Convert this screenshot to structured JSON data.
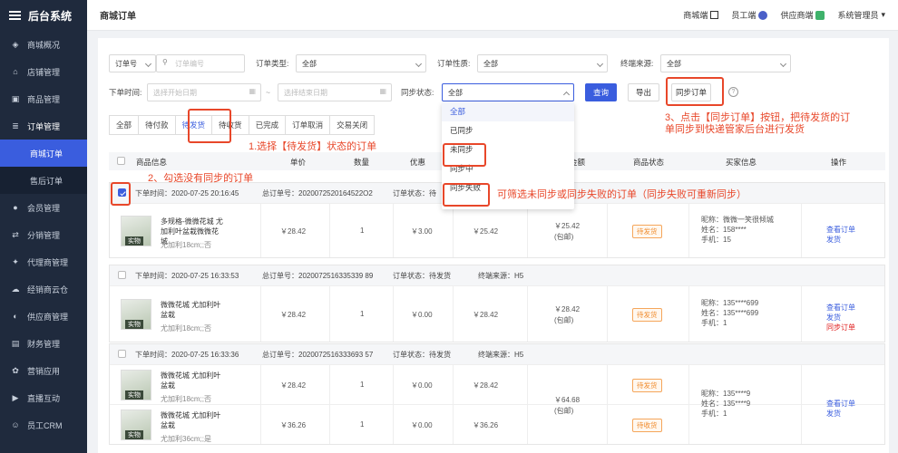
{
  "app": {
    "title": "后台系统"
  },
  "sidebar": {
    "items": [
      {
        "label": "商城概况",
        "icon": "layers-icon"
      },
      {
        "label": "店铺管理",
        "icon": "shop-icon"
      },
      {
        "label": "商品管理",
        "icon": "box-icon"
      },
      {
        "label": "订单管理",
        "icon": "order-icon"
      },
      {
        "label": "商城订单",
        "sub": true,
        "active": true
      },
      {
        "label": "售后订单",
        "sub": true
      },
      {
        "label": "会员管理",
        "icon": "user-icon"
      },
      {
        "label": "分销管理",
        "icon": "share-icon"
      },
      {
        "label": "代理商管理",
        "icon": "agent-icon"
      },
      {
        "label": "经销商云仓",
        "icon": "cloud-icon"
      },
      {
        "label": "供应商管理",
        "icon": "supplier-icon"
      },
      {
        "label": "财务管理",
        "icon": "wallet-icon"
      },
      {
        "label": "营销应用",
        "icon": "apps-icon"
      },
      {
        "label": "直播互动",
        "icon": "video-icon"
      },
      {
        "label": "员工CRM",
        "icon": "crm-icon"
      }
    ]
  },
  "topbar": {
    "page_title": "商城订单",
    "mall_end": "商城端",
    "staff_end": "员工端",
    "supplier_end": "供应商端",
    "admin": "系统管理员"
  },
  "filters": {
    "order_no_type": "订单号",
    "order_no_placeholder": "订单编号",
    "order_type_label": "订单类型:",
    "order_type_value": "全部",
    "order_nature_label": "订单性质:",
    "order_nature_value": "全部",
    "terminal_label": "终端来源:",
    "terminal_value": "全部",
    "time_label": "下单时间:",
    "start_placeholder": "选择开始日期",
    "end_placeholder": "选择结束日期",
    "sep": "~",
    "sync_label": "同步状态:",
    "sync_value": "全部",
    "search_btn": "查询",
    "export_btn": "导出",
    "sync_btn": "同步订单"
  },
  "tabs": [
    "全部",
    "待付款",
    "待发货",
    "待收货",
    "已完成",
    "订单取消",
    "交易关闭"
  ],
  "dropdown_options": [
    "全部",
    "已同步",
    "未同步",
    "同步中",
    "同步失败"
  ],
  "columns": [
    "商品信息",
    "单价",
    "数量",
    "优惠",
    "金额",
    "商品状态",
    "买家信息",
    "操作"
  ],
  "orders": [
    {
      "time": "下单时间：2020-07-25 20:16:45",
      "no": "总订单号：2020072520164522O2",
      "status": "订单状态：待",
      "products": [
        {
          "name": "多规格-微微花城 尤加利叶盆栽微微花城",
          "sku": "尤加利18cm;;否",
          "price": "￥28.42",
          "qty": "1",
          "discount": "￥3.00",
          "subtotal": "￥25.42",
          "state": "待发货"
        }
      ],
      "amount": "￥25.42",
      "amount_note": "(包邮)",
      "buyer": [
        "昵称：微微一笑很倾城",
        "姓名：158****",
        "手机：15"
      ],
      "actions": [
        "查看订单",
        "发货"
      ]
    },
    {
      "time": "下单时间：2020-07-25 16:33:53",
      "no": "总订单号：2020072516335339 89",
      "status": "订单状态：待发货",
      "terminal": "终端来源：H5",
      "products": [
        {
          "name": "微微花城 尤加利叶盆栽",
          "sku": "尤加利18cm;;否",
          "price": "￥28.42",
          "qty": "1",
          "discount": "￥0.00",
          "subtotal": "￥28.42",
          "state": "待发货"
        }
      ],
      "amount": "￥28.42",
      "amount_note": "(包邮)",
      "buyer": [
        "昵称：135****699",
        "姓名：135****699",
        "手机：1"
      ],
      "actions": [
        "查看订单",
        "发货",
        "同步订单"
      ]
    },
    {
      "time": "下单时间：2020-07-25 16:33:36",
      "no": "总订单号：2020072516333693 57",
      "status": "订单状态：待发货",
      "terminal": "终端来源：H5",
      "products": [
        {
          "name": "微微花城 尤加利叶盆栽",
          "sku": "尤加利18cm;;否",
          "price": "￥28.42",
          "qty": "1",
          "discount": "￥0.00",
          "subtotal": "￥28.42",
          "state": "待发货"
        },
        {
          "name": "微微花城 尤加利叶盆栽",
          "sku": "尤加利36cm;;是",
          "price": "￥36.26",
          "qty": "1",
          "discount": "￥0.00",
          "subtotal": "￥36.26",
          "state": "待收货"
        }
      ],
      "amount": "￥64.68",
      "amount_note": "(包邮)",
      "buyer": [
        "昵称：135****9",
        "姓名：135****9",
        "手机：1"
      ],
      "actions": [
        "查看订单",
        "发货"
      ]
    }
  ],
  "annotations": {
    "a1": "1.选择【待发货】状态的订单",
    "a2": "2、勾选没有同步的订单",
    "a3": "3、点击【同步订单】按钮，把待发货的订单同步到快递管家后台进行发货",
    "a4": "可筛选未同步或同步失败的订单（同步失败可重新同步）"
  },
  "colors": {
    "primary": "#3a5dde",
    "sidebar": "#1f2a3d",
    "annotation": "#e8472a"
  }
}
